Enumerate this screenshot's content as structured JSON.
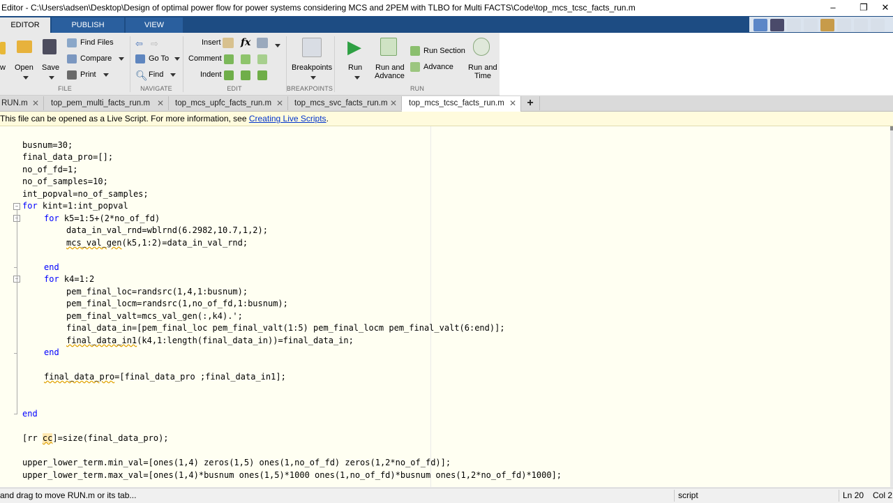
{
  "window": {
    "title": "Editor - C:\\Users\\adsen\\Desktop\\Design of optimal power flow for power systems considering MCS and 2PEM with TLBO for Multi FACTS\\Code\\top_mcs_tcsc_facts_run.m",
    "minimize": "–",
    "restore": "❐",
    "close": "✕"
  },
  "ribbon_tabs": [
    "EDITOR",
    "PUBLISH",
    "VIEW"
  ],
  "ribbon": {
    "file": {
      "new_label": "w",
      "open_label": "Open",
      "save_label": "Save",
      "find_files_label": "Find Files",
      "compare_label": "Compare",
      "print_label": "Print",
      "group_label": "FILE"
    },
    "navigate": {
      "goto_label": "Go To",
      "find_label": "Find",
      "group_label": "NAVIGATE"
    },
    "edit": {
      "insert_label": "Insert",
      "fx_label": "fx",
      "comment_label": "Comment",
      "indent_label": "Indent",
      "group_label": "EDIT"
    },
    "breakpoints": {
      "label": "Breakpoints",
      "group_label": "BREAKPOINTS"
    },
    "run": {
      "run_label": "Run",
      "run_advance_line1": "Run and",
      "run_advance_line2": "Advance",
      "run_section_label": "Run Section",
      "advance_label": "Advance",
      "run_time_line1": "Run and",
      "run_time_line2": "Time",
      "group_label": "RUN"
    }
  },
  "file_tabs": [
    {
      "label": "RUN.m",
      "active": false
    },
    {
      "label": "top_pem_multi_facts_run.m",
      "active": false
    },
    {
      "label": "top_mcs_upfc_facts_run.m",
      "active": false
    },
    {
      "label": "top_mcs_svc_facts_run.m",
      "active": false
    },
    {
      "label": "top_mcs_tcsc_facts_run.m",
      "active": true
    }
  ],
  "new_tab_label": "+",
  "tab_close_glyph": "✕",
  "info_bar": {
    "text": "This file can be opened as a Live Script. For more information, see ",
    "link": "Creating Live Scripts",
    "suffix": "."
  },
  "code": {
    "l1": "busnum=30;",
    "l2": "final_data_pro=[];",
    "l3": "no_of_fd=1;",
    "l4": "no_of_samples=10;",
    "l5": "int_popval=no_of_samples;",
    "l6_kw": "for",
    "l6_rest": " kint=1:int_popval",
    "l7_kw": "for",
    "l7_rest": " k5=1:5+(2*no_of_fd)",
    "l8": "data_in_val_rnd=wblrnd(6.2982,10.7,1,2);",
    "l9_a": "mcs_val_gen",
    "l9_b": "(k5,1:2)=data_in_val_rnd;",
    "l10_kw": "end",
    "l11_kw": "for",
    "l11_rest": " k4=1:2",
    "l12": "pem_final_loc=randsrc(1,4,1:busnum);",
    "l13": "pem_final_locm=randsrc(1,no_of_fd,1:busnum);",
    "l14": "pem_final_valt=mcs_val_gen(:,k4).';",
    "l15": "final_data_in=[pem_final_loc pem_final_valt(1:5) pem_final_locm pem_final_valt(6:end)];",
    "l16_a": "final_data_in1",
    "l16_b": "(k4,1:length(final_data_in))=final_data_in;",
    "l17_kw": "end",
    "l18_a": "final_data_pro",
    "l18_b": "=[final_data_pro ;final_data_in1];",
    "l19_kw": "end",
    "l20_a": "[rr ",
    "l20_b": "cc",
    "l20_c": "]=size(final_data_pro);",
    "l21": "upper_lower_term.min_val=[ones(1,4) zeros(1,5) ones(1,no_of_fd) zeros(1,2*no_of_fd)];",
    "l22": "upper_lower_term.max_val=[ones(1,4)*busnum ones(1,5)*1000 ones(1,no_of_fd)*busnum ones(1,2*no_of_fd)*1000];"
  },
  "status": {
    "message": " and drag to move RUN.m or its tab...",
    "mode": "script",
    "ln": "Ln  20",
    "col": "Col  2"
  },
  "colors": {
    "keyword": "#0000ff",
    "tab_strip": "#1d4c83",
    "editor_bg": "#fffff2",
    "info_bg": "#fffbdd"
  }
}
